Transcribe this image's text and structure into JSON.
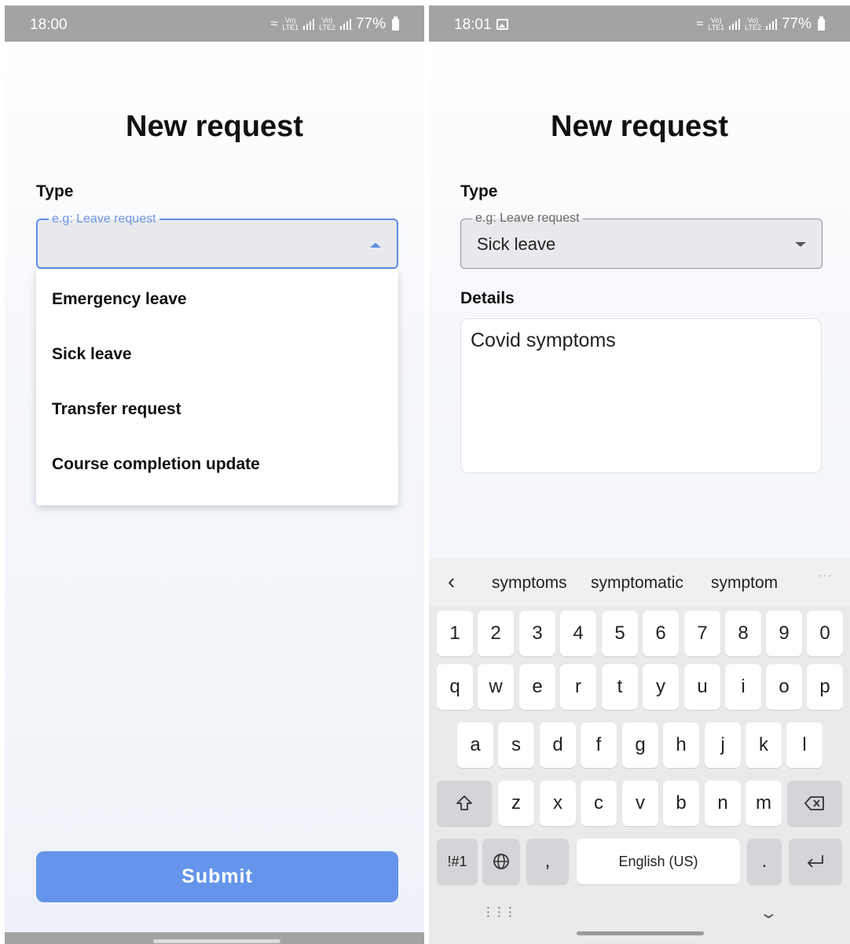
{
  "left": {
    "status": {
      "time": "18:00",
      "battery": "77%"
    },
    "title": "New request",
    "type_label": "Type",
    "type_select": {
      "placeholder": "e.g: Leave request",
      "value": ""
    },
    "menu": [
      {
        "label": "Emergency leave"
      },
      {
        "label": "Sick leave"
      },
      {
        "label": "Transfer request"
      },
      {
        "label": "Course completion update"
      }
    ],
    "submit_label": "Submit"
  },
  "right": {
    "status": {
      "time": "18:01",
      "battery": "77%"
    },
    "title": "New request",
    "type_label": "Type",
    "type_select": {
      "placeholder": "e.g: Leave request",
      "value": "Sick leave"
    },
    "details_label": "Details",
    "details_value": "Covid symptoms",
    "keyboard": {
      "suggestions": [
        "symptoms",
        "symptomatic",
        "symptom"
      ],
      "rows": [
        [
          "1",
          "2",
          "3",
          "4",
          "5",
          "6",
          "7",
          "8",
          "9",
          "0"
        ],
        [
          "q",
          "w",
          "e",
          "r",
          "t",
          "y",
          "u",
          "i",
          "o",
          "p"
        ],
        [
          "a",
          "s",
          "d",
          "f",
          "g",
          "h",
          "j",
          "k",
          "l"
        ],
        [
          "z",
          "x",
          "c",
          "v",
          "b",
          "n",
          "m"
        ]
      ],
      "symbols_key": "!#1",
      "comma_key": ",",
      "space_label": "English (US)",
      "period_key": "."
    }
  },
  "colors": {
    "accent": "#6495ea",
    "focus_border": "#5b8fe3",
    "status_bar": "#a3a3a3"
  },
  "icons": [
    "wifi-icon",
    "signal-icon",
    "battery-icon",
    "gallery-icon",
    "chevron-left-icon",
    "more-dots-icon",
    "shift-icon",
    "backspace-icon",
    "globe-icon",
    "enter-icon",
    "keyboard-grid-icon",
    "keyboard-hide-icon"
  ]
}
